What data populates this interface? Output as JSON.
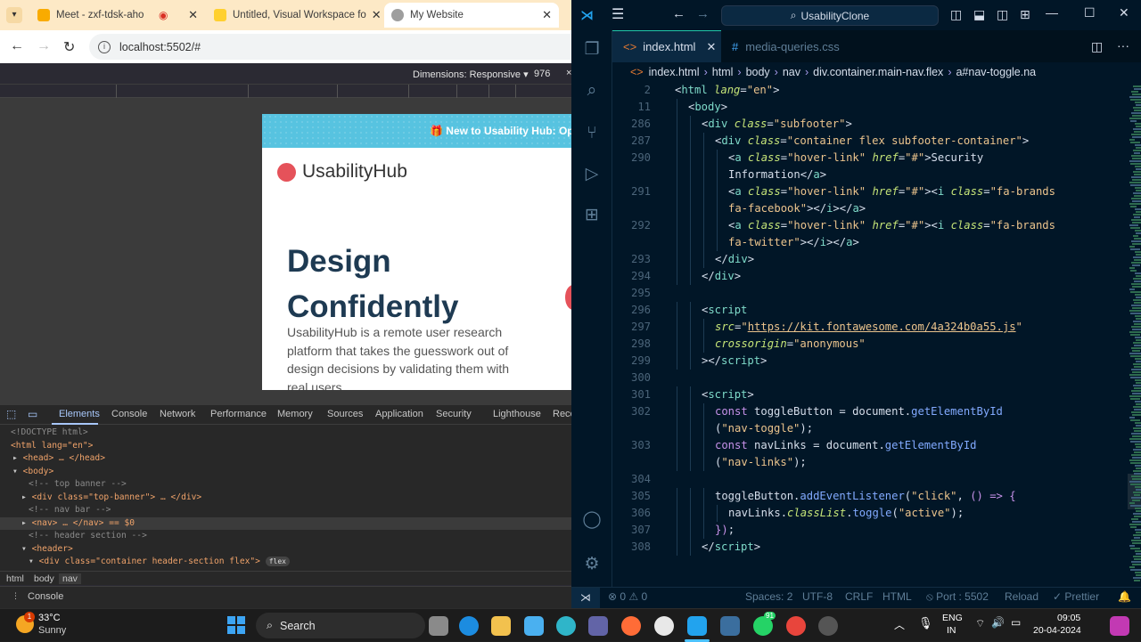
{
  "browser": {
    "tabs": [
      {
        "title": "Meet - zxf-tdsk-aho",
        "fav_color": "#f9ab00"
      },
      {
        "title": "Untitled, Visual Workspace fo",
        "fav_color": "#ffd02f"
      },
      {
        "title": "My Website",
        "fav_color": "#9e9e9e"
      }
    ],
    "tab_close": "✕",
    "url": "localhost:5502/#",
    "device_toolbar": {
      "dimensions": "Dimensions: Responsive ▾",
      "width": "976",
      "close": "×"
    },
    "page": {
      "banner": "🎁 New to Usability Hub: Op",
      "logo": "UsabilityHub",
      "hero_line1": "Design",
      "hero_line2": "Confidently",
      "hero_desc": "UsabilityHub is a remote user research platform that takes the guesswork out of design decisions by validating them with real users"
    },
    "devtools": {
      "tabs": [
        "Elements",
        "Console",
        "Network",
        "Performance",
        "Memory",
        "Sources",
        "Application",
        "Security",
        "Lighthouse",
        "Reco"
      ],
      "dom": [
        "<!DOCTYPE html>",
        "<html lang=\"en\">",
        "<head> … </head>",
        "<body>",
        "<!-- top banner -->",
        "<div class=\"top-banner\"> … </div>",
        "<!-- nav bar -->",
        "<nav> … </nav> == $0",
        "<!-- header section -->",
        "<header>",
        "<div class=\"container header-section flex\">"
      ],
      "flex_badge": "flex",
      "breadcrumbs": [
        "html",
        "body",
        "nav"
      ],
      "console_drawer": "Console"
    }
  },
  "vscode": {
    "command_center": "UsabilityClone",
    "tabs": [
      {
        "name": "index.html",
        "icon": "<>"
      },
      {
        "name": "media-queries.css",
        "icon": "#"
      }
    ],
    "breadcrumbs": [
      "index.html",
      "html",
      "body",
      "nav",
      "div.container.main-nav.flex",
      "a#nav-toggle.na"
    ],
    "lines": [
      {
        "n": "2",
        "html": "<span class='p'>&lt;</span><span class='t'>html</span> <span class='a'>lang</span><span class='p'>=</span><span class='s'>\"en\"</span><span class='p'>&gt;</span>",
        "indent": 0
      },
      {
        "n": "11",
        "html": "<span class='p'>&lt;</span><span class='t'>body</span><span class='p'>&gt;</span>",
        "indent": 1
      },
      {
        "n": "286",
        "html": "<span class='p'>&lt;</span><span class='t'>div</span> <span class='a'>class</span><span class='p'>=</span><span class='s'>\"subfooter\"</span><span class='p'>&gt;</span>",
        "indent": 2
      },
      {
        "n": "287",
        "html": "<span class='p'>&lt;</span><span class='t'>div</span> <span class='a'>class</span><span class='p'>=</span><span class='s'>\"container flex subfooter-container\"</span><span class='p'>&gt;</span>",
        "indent": 3
      },
      {
        "n": "290",
        "html": "<span class='p'>&lt;</span><span class='t'>a</span> <span class='a'>class</span><span class='p'>=</span><span class='s'>\"hover-link\"</span> <span class='a'>href</span><span class='p'>=</span><span class='s'>\"#\"</span><span class='p'>&gt;Security</span>",
        "indent": 4
      },
      {
        "n": "",
        "html": "<span class='p'>Information&lt;/</span><span class='t'>a</span><span class='p'>&gt;</span>",
        "indent": 4
      },
      {
        "n": "291",
        "html": "<span class='p'>&lt;</span><span class='t'>a</span> <span class='a'>class</span><span class='p'>=</span><span class='s'>\"hover-link\"</span> <span class='a'>href</span><span class='p'>=</span><span class='s'>\"#\"</span><span class='p'>&gt;&lt;</span><span class='t'>i</span> <span class='a'>class</span><span class='p'>=</span><span class='s'>\"fa-brands</span>",
        "indent": 4
      },
      {
        "n": "",
        "html": "<span class='s'>fa-facebook\"</span><span class='p'>&gt;&lt;/</span><span class='t'>i</span><span class='p'>&gt;&lt;/</span><span class='t'>a</span><span class='p'>&gt;</span>",
        "indent": 4
      },
      {
        "n": "292",
        "html": "<span class='p'>&lt;</span><span class='t'>a</span> <span class='a'>class</span><span class='p'>=</span><span class='s'>\"hover-link\"</span> <span class='a'>href</span><span class='p'>=</span><span class='s'>\"#\"</span><span class='p'>&gt;&lt;</span><span class='t'>i</span> <span class='a'>class</span><span class='p'>=</span><span class='s'>\"fa-brands</span>",
        "indent": 4
      },
      {
        "n": "",
        "html": "<span class='s'>fa-twitter\"</span><span class='p'>&gt;&lt;/</span><span class='t'>i</span><span class='p'>&gt;&lt;/</span><span class='t'>a</span><span class='p'>&gt;</span>",
        "indent": 4
      },
      {
        "n": "293",
        "html": "<span class='p'>&lt;/</span><span class='t'>div</span><span class='p'>&gt;</span>",
        "indent": 3
      },
      {
        "n": "294",
        "html": "<span class='p'>&lt;/</span><span class='t'>div</span><span class='p'>&gt;</span>",
        "indent": 2
      },
      {
        "n": "295",
        "html": "",
        "indent": 0
      },
      {
        "n": "296",
        "html": "<span class='p'>&lt;</span><span class='t'>script</span>",
        "indent": 2
      },
      {
        "n": "297",
        "html": "<span class='a'>src</span><span class='p'>=</span><span class='s'>\"</span><span class='u'>https://kit.fontawesome.com/4a324b0a55.js</span><span class='s'>\"</span>",
        "indent": 3
      },
      {
        "n": "298",
        "html": "<span class='a'>crossorigin</span><span class='p'>=</span><span class='s'>\"anonymous\"</span>",
        "indent": 3
      },
      {
        "n": "299",
        "html": "<span class='p'>&gt;&lt;/</span><span class='t'>script</span><span class='p'>&gt;</span>",
        "indent": 2
      },
      {
        "n": "300",
        "html": "",
        "indent": 0
      },
      {
        "n": "301",
        "html": "<span class='p'>&lt;</span><span class='t'>script</span><span class='p'>&gt;</span>",
        "indent": 2
      },
      {
        "n": "302",
        "html": "<span class='k'>const</span> <span class='p'>toggleButton = document.</span><span class='f'>getElementById</span>",
        "indent": 3
      },
      {
        "n": "",
        "html": "<span class='p'>(</span><span class='s'>\"nav-toggle\"</span><span class='p'>);</span>",
        "indent": 3
      },
      {
        "n": "303",
        "html": "<span class='k'>const</span> <span class='p'>navLinks = document.</span><span class='f'>getElementById</span>",
        "indent": 3
      },
      {
        "n": "",
        "html": "<span class='p'>(</span><span class='s'>\"nav-links\"</span><span class='p'>);</span>",
        "indent": 3
      },
      {
        "n": "304",
        "html": "",
        "indent": 0
      },
      {
        "n": "305",
        "html": "<span class='p'>toggleButton.</span><span class='f'>addEventListener</span><span class='p'>(</span><span class='s'>\"click\"</span><span class='p'>, </span><span class='k'>() =&gt; {</span>",
        "indent": 3
      },
      {
        "n": "306",
        "html": "<span class='p'>navLinks.</span><span class='a'>classList</span><span class='p'>.</span><span class='f'>toggle</span><span class='p'>(</span><span class='s'>\"active\"</span><span class='p'>);</span>",
        "indent": 4
      },
      {
        "n": "307",
        "html": "<span class='k'>})</span><span class='p'>;</span>",
        "indent": 3
      },
      {
        "n": "308",
        "html": "<span class='p'>&lt;/</span><span class='t'>script</span><span class='p'>&gt;</span>",
        "indent": 2
      }
    ],
    "status": {
      "errors": "⊗ 0  ⚠ 0",
      "spaces": "Spaces: 2",
      "encoding": "UTF-8",
      "eol": "CRLF",
      "language": "HTML",
      "port": "⦸ Port : 5502",
      "reload": "Reload",
      "prettier": "✓ Prettier"
    }
  },
  "taskbar": {
    "weather_temp": "33°C",
    "weather_desc": "Sunny",
    "weather_badge": "1",
    "search": "Search",
    "lang1": "ENG",
    "lang2": "IN",
    "time": "09:05",
    "date": "20-04-2024",
    "whatsapp_badge": "91"
  }
}
